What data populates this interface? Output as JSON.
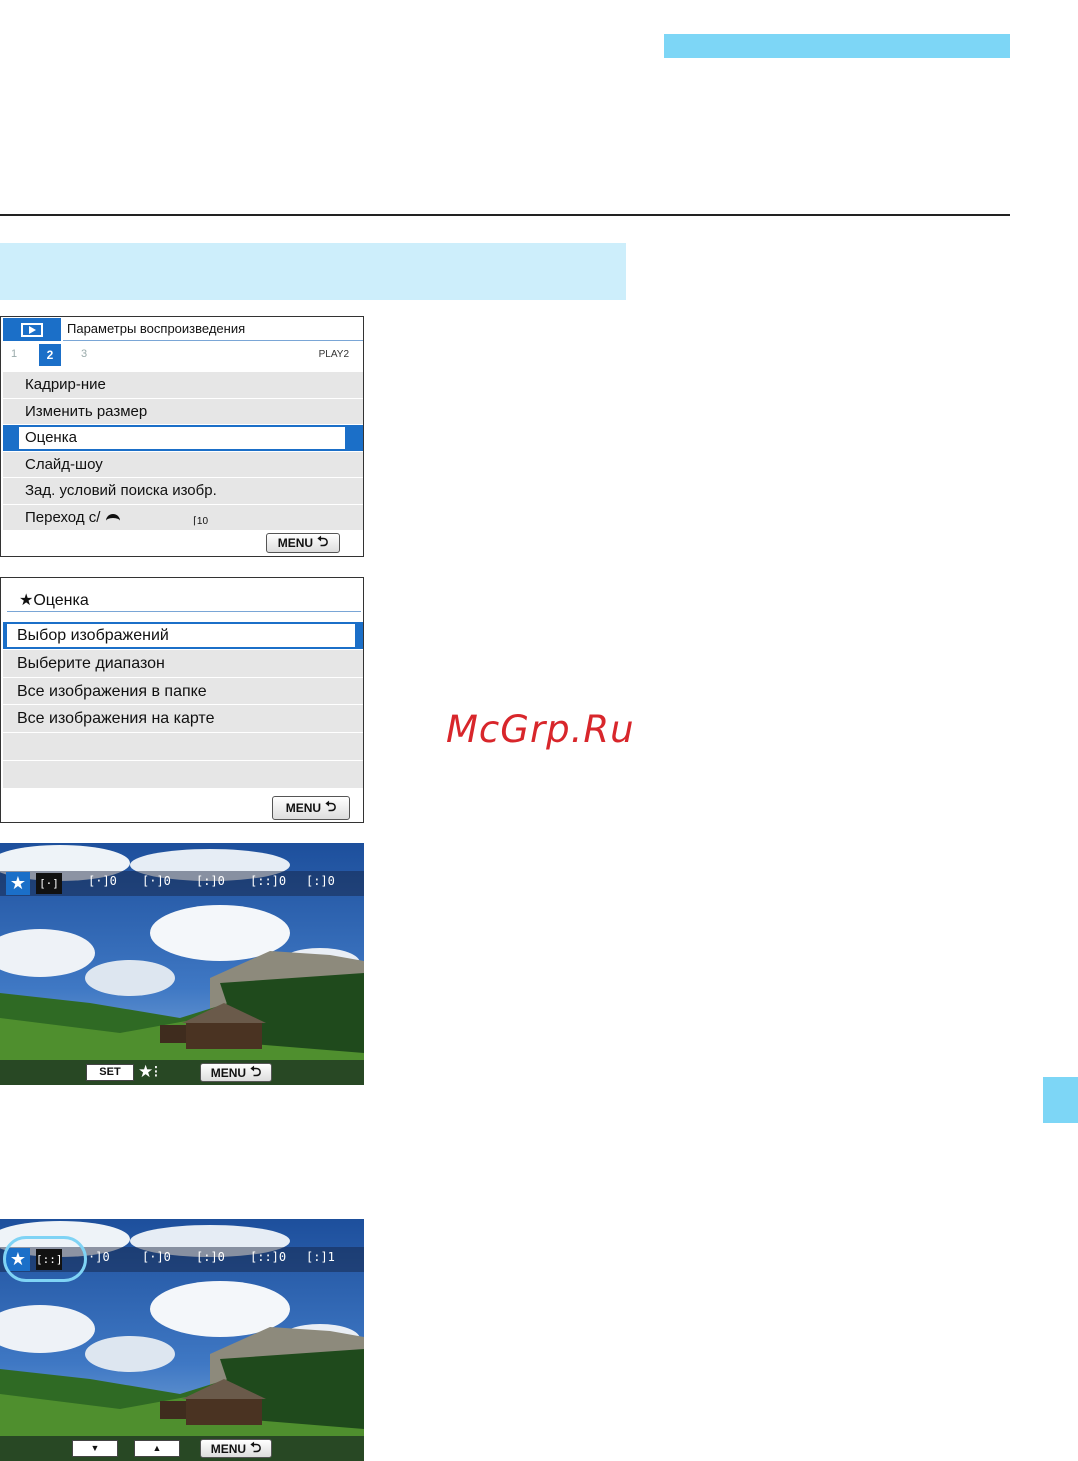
{
  "screen1": {
    "title": "Параметры воспроизведения",
    "tabs": [
      "1",
      "2",
      "3"
    ],
    "active_tab": "2",
    "page_code": "PLAY2",
    "items": [
      "Кадрир-ние",
      "Изменить размер",
      "Оценка",
      "Слайд-шоу",
      "Зад. условий поиска изобр.",
      "Переход с/"
    ],
    "selected_index": 2,
    "jump_value": "10",
    "menu_label": "MENU"
  },
  "screen2": {
    "title": "★Оценка",
    "items": [
      "Выбор изображений",
      "Выберите диапазон",
      "Все изображения в папке",
      "Все изображения на карте"
    ],
    "selected_index": 0,
    "menu_label": "MENU"
  },
  "screen3": {
    "star": "★",
    "selected_icon": "[·]",
    "icons": [
      "[·]0",
      "[·]0",
      "[:]0",
      "[::]0",
      "[:]0"
    ],
    "set_label": "SET",
    "menu_label": "MENU"
  },
  "screen4": {
    "star": "★",
    "selected_icon": "[::]",
    "icons": [
      "·]0",
      "[·]0",
      "[:]0",
      "[::]0",
      "[:]1"
    ],
    "down_label": "▼",
    "up_label": "▲",
    "menu_label": "MENU"
  },
  "watermark": "McGrp.Ru",
  "colors": {
    "accent_blue": "#1b6fc8",
    "light_cyan": "#7dd6f6",
    "band_cyan": "#cdeefb",
    "watermark_red": "#d8262b"
  }
}
